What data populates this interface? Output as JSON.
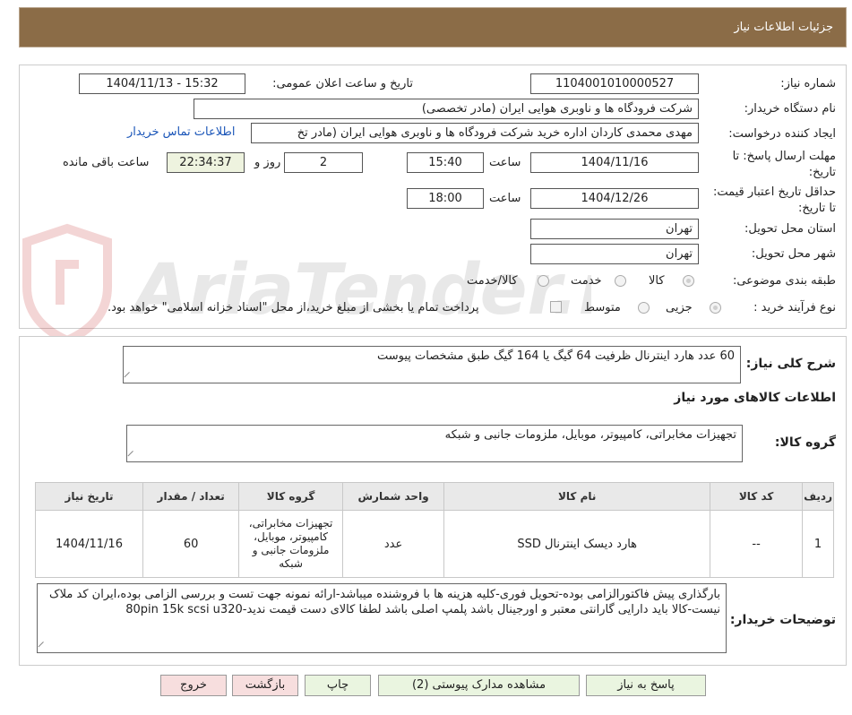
{
  "header": {
    "title": "جزئیات اطلاعات نیاز"
  },
  "watermark": {
    "text": "AriaTender.neT"
  },
  "form": {
    "need_number_label": "شماره نیاز:",
    "need_number": "1104001010000527",
    "announce_label": "تاریخ و ساعت اعلان عمومی:",
    "announce_value": "1404/11/13 - 15:32",
    "buyer_org_label": "نام دستگاه خریدار:",
    "buyer_org": "شرکت فرودگاه ها و ناوبری هوایی ایران (مادر تخصصی)",
    "creator_label": "ایجاد کننده درخواست:",
    "creator": "مهدی محمدی کاردان اداره خرید شرکت فرودگاه ها و ناوبری هوایی ایران (مادر تخ",
    "contact_link": "اطلاعات تماس خریدار",
    "reply_deadline_label": "مهلت ارسال پاسخ: تا تاریخ:",
    "reply_date": "1404/11/16",
    "time_label": "ساعت",
    "reply_time": "15:40",
    "days": "2",
    "days_label": "روز و",
    "remaining_time": "22:34:37",
    "remaining_label": "ساعت باقی مانده",
    "validity_label": "حداقل تاریخ اعتبار قیمت: تا تاریخ:",
    "validity_date": "1404/12/26",
    "validity_time": "18:00",
    "province_label": "استان محل تحویل:",
    "province": "تهران",
    "city_label": "شهر محل تحویل:",
    "city": "تهران",
    "category_label": "طبقه بندی موضوعی:",
    "category_options": [
      "کالا",
      "خدمت",
      "کالا/خدمت"
    ],
    "process_label": "نوع فرآیند خرید :",
    "process_options": [
      "جزیی",
      "متوسط"
    ],
    "payment_note": "پرداخت تمام یا بخشی از مبلغ خرید،از محل \"اسناد خزانه اسلامی\" خواهد بود."
  },
  "details": {
    "summary_label": "شرح کلی نیاز:",
    "summary": "60 عدد هارد اینترنال ظرفیت 64 گیگ یا 164 گیگ طبق مشخصات پیوست",
    "goods_info_title": "اطلاعات کالاهای مورد نیاز",
    "goods_group_label": "گروه کالا:",
    "goods_group": "تجهیزات مخابراتی، کامپیوتر، موبایل، ملزومات جانبی و شبکه",
    "table_headers": [
      "ردیف",
      "کد کالا",
      "نام کالا",
      "واحد شمارش",
      "گروه کالا",
      "تعداد / مقدار",
      "تاریخ نیاز"
    ],
    "rows": [
      [
        "1",
        "--",
        "هارد دیسک اینترنال SSD",
        "عدد",
        "تجهیزات مخابراتی، کامپیوتر، موبایل، ملزومات جانبی و شبکه",
        "60",
        "1404/11/16"
      ]
    ],
    "buyer_notes_label": "توضیحات خریدار:",
    "buyer_notes": "بارگذاری پیش فاکتورالزامی بوده-تحویل فوری-کلیه هزینه ها با فروشنده میباشد-ارائه نمونه جهت تست و بررسی الزامی بوده،ایران کد ملاک نیست-کالا باید دارایی گارانتی معتبر و اورجینال باشد پلمپ اصلی باشد لطفا کالای دست قیمت ندید-80pin 15k scsi u320"
  },
  "buttons": {
    "reply": "پاسخ به نیاز",
    "attachments": "مشاهده مدارک پیوستی (2)",
    "print": "چاپ",
    "back": "بازگشت",
    "exit": "خروج"
  }
}
